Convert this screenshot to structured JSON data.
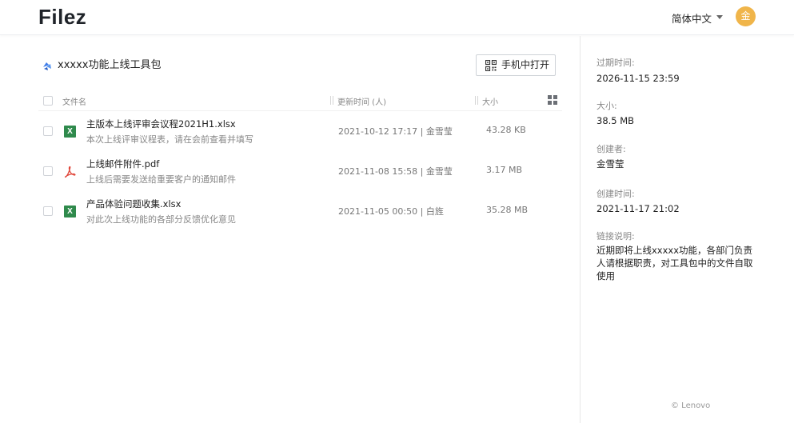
{
  "app": {
    "logo": "Filez"
  },
  "header": {
    "language": "简体中文",
    "avatar_initial": "金"
  },
  "folder": {
    "title": "xxxxx功能上线工具包"
  },
  "toolbar": {
    "open_mobile_label": "手机中打开"
  },
  "table": {
    "columns": {
      "name": "文件名",
      "updated": "更新时间 (人)",
      "size": "大小"
    },
    "rows": [
      {
        "name": "主版本上线评审会议程2021H1.xlsx",
        "description": "本次上线评审议程表，请在会前查看并填写",
        "updated": "2021-10-12 17:17 | 金雪莹",
        "size": "43.28 KB",
        "type": "xlsx",
        "icon_label": "X"
      },
      {
        "name": "上线邮件附件.pdf",
        "description": "上线后需要发送给重要客户的通知邮件",
        "updated": "2021-11-08 15:58 | 金雪莹",
        "size": "3.17 MB",
        "type": "pdf",
        "icon_label": ""
      },
      {
        "name": "产品体验问题收集.xlsx",
        "description": "对此次上线功能的各部分反馈优化意见",
        "updated": "2021-11-05 00:50 | 白旌",
        "size": "35.28 MB",
        "type": "xlsx",
        "icon_label": "X"
      }
    ]
  },
  "details": {
    "expire_label": "过期时间:",
    "expire_value": "2026-11-15 23:59",
    "size_label": "大小:",
    "size_value": "38.5 MB",
    "creator_label": "创建者:",
    "creator_value": "金雪莹",
    "created_label": "创建时间:",
    "created_value": "2021-11-17 21:02",
    "link_desc_label": "链接说明:",
    "link_desc_value": "近期即将上线xxxxx功能，各部门负责人请根据职责，对工具包中的文件自取使用"
  },
  "footer": {
    "copyright": "© Lenovo"
  },
  "colors": {
    "avatar": "#f0b54a",
    "excel": "#2f8a4c",
    "pdf": "#e0463a",
    "folder": "#3d7be8"
  }
}
